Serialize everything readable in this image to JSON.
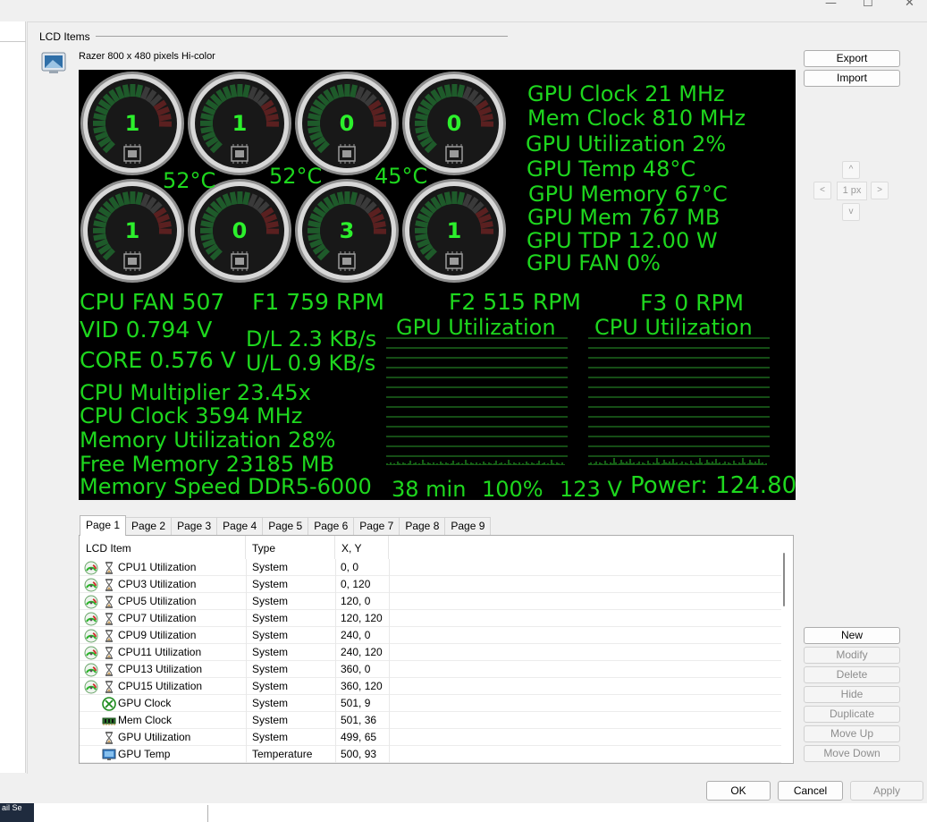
{
  "window": {
    "controls": [
      "minimize-icon",
      "maximize-icon",
      "close-icon"
    ]
  },
  "group": {
    "label": "LCD Items",
    "device_name": "Razer 800 x 480 pixels Hi-color"
  },
  "lcd": {
    "gauges": [
      "1",
      "1",
      "0",
      "0",
      "1",
      "0",
      "3",
      "1"
    ],
    "temps": [
      "52°C",
      "52°C",
      "45°C"
    ],
    "gpu_lines": [
      "GPU Clock 21 MHz",
      "Mem Clock 810 MHz",
      "GPU Utilization 2%",
      "GPU Temp 48°C",
      "GPU Memory 67°C",
      "GPU Mem 767 MB",
      "GPU TDP 12.00 W",
      "GPU FAN 0%"
    ],
    "cpu_fan": "CPU FAN 507",
    "f1": "F1 759 RPM",
    "f2": "F2 515 RPM",
    "f3": "F3 0 RPM",
    "vid": "VID 0.794 V",
    "core": "CORE 0.576 V",
    "download": "D/L 2.3 KB/s",
    "upload": "U/L 0.9 KB/s",
    "gpu_graph_title": "GPU Utilization",
    "cpu_graph_title": "CPU Utilization",
    "cpu_multiplier": "CPU Multiplier 23.45x",
    "cpu_clock": "CPU Clock 3594 MHz",
    "memory_utilization": "Memory Utilization 28%",
    "free_memory": "Free Memory 23185 MB",
    "memory_speed": "Memory Speed DDR5-6000",
    "time": "38 min",
    "percent": "100%",
    "voltage": "123 V",
    "power": "Power: 124.80",
    "text_color": "#1ed71e",
    "background_color": "#000000"
  },
  "side_buttons": {
    "export": "Export",
    "import": "Import",
    "nudge_up": "^",
    "nudge_down": "v",
    "nudge_left": "<",
    "nudge_right": ">",
    "nudge_step": "1 px",
    "new": "New",
    "modify": "Modify",
    "delete": "Delete",
    "hide": "Hide",
    "duplicate": "Duplicate",
    "move_up": "Move Up",
    "move_down": "Move Down"
  },
  "tabs": [
    "Page 1",
    "Page 2",
    "Page 3",
    "Page 4",
    "Page 5",
    "Page 6",
    "Page 7",
    "Page 8",
    "Page 9"
  ],
  "active_tab": "Page 1",
  "list": {
    "columns": [
      "LCD Item",
      "Type",
      "X, Y"
    ],
    "rows": [
      {
        "icons": [
          "gauge-icon",
          "hourglass-icon"
        ],
        "name": "CPU1 Utilization",
        "type": "System",
        "xy": "0, 0"
      },
      {
        "icons": [
          "gauge-icon",
          "hourglass-icon"
        ],
        "name": "CPU3 Utilization",
        "type": "System",
        "xy": "0, 120"
      },
      {
        "icons": [
          "gauge-icon",
          "hourglass-icon"
        ],
        "name": "CPU5 Utilization",
        "type": "System",
        "xy": "120, 0"
      },
      {
        "icons": [
          "gauge-icon",
          "hourglass-icon"
        ],
        "name": "CPU7 Utilization",
        "type": "System",
        "xy": "120, 120"
      },
      {
        "icons": [
          "gauge-icon",
          "hourglass-icon"
        ],
        "name": "CPU9 Utilization",
        "type": "System",
        "xy": "240, 0"
      },
      {
        "icons": [
          "gauge-icon",
          "hourglass-icon"
        ],
        "name": "CPU11 Utilization",
        "type": "System",
        "xy": "240, 120"
      },
      {
        "icons": [
          "gauge-icon",
          "hourglass-icon"
        ],
        "name": "CPU13 Utilization",
        "type": "System",
        "xy": "360, 0"
      },
      {
        "icons": [
          "gauge-icon",
          "hourglass-icon"
        ],
        "name": "CPU15 Utilization",
        "type": "System",
        "xy": "360, 120"
      },
      {
        "icons": [
          "xbox-icon"
        ],
        "name": "GPU Clock",
        "type": "System",
        "xy": "501, 9"
      },
      {
        "icons": [
          "memory-chip-icon"
        ],
        "name": "Mem Clock",
        "type": "System",
        "xy": "501, 36"
      },
      {
        "icons": [
          "hourglass-icon"
        ],
        "name": "GPU Utilization",
        "type": "System",
        "xy": "499, 65"
      },
      {
        "icons": [
          "monitor-icon"
        ],
        "name": "GPU Temp",
        "type": "Temperature",
        "xy": "500, 93"
      }
    ]
  },
  "dialog": {
    "ok": "OK",
    "cancel": "Cancel",
    "apply": "Apply"
  },
  "taskbar": {
    "label": "ail Se"
  }
}
